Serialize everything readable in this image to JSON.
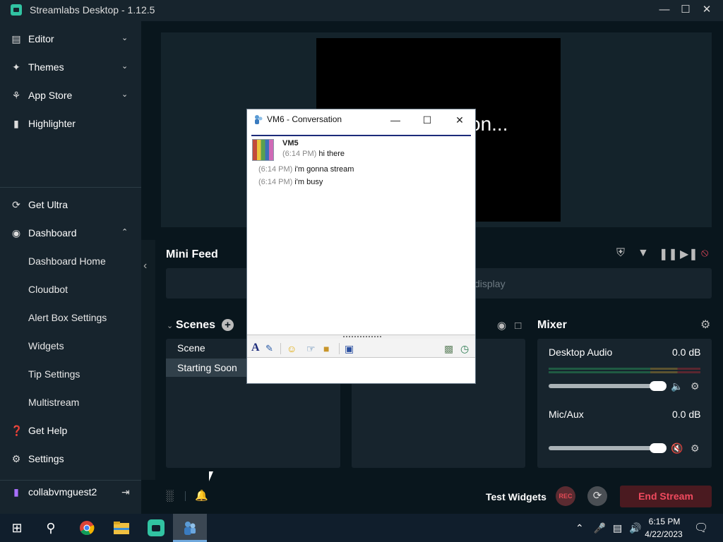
{
  "window": {
    "title": "Streamlabs Desktop - 1.12.5",
    "controls": [
      "minimize",
      "maximize",
      "close"
    ]
  },
  "sidebar": {
    "nav": [
      {
        "label": "Editor",
        "icon": "editor-icon",
        "chevron": "down"
      },
      {
        "label": "Themes",
        "icon": "themes-icon",
        "chevron": "down"
      },
      {
        "label": "App Store",
        "icon": "app-store-icon",
        "chevron": "down"
      },
      {
        "label": "Highlighter",
        "icon": "highlighter-icon"
      }
    ],
    "bottom": [
      {
        "label": "Get Ultra",
        "icon": "ultra-icon"
      },
      {
        "label": "Dashboard",
        "icon": "dashboard-icon",
        "chevron": "up"
      },
      {
        "label": "Dashboard Home"
      },
      {
        "label": "Cloudbot"
      },
      {
        "label": "Alert Box Settings"
      },
      {
        "label": "Widgets"
      },
      {
        "label": "Tip Settings"
      },
      {
        "label": "Multistream"
      },
      {
        "label": "Get Help",
        "icon": "help-icon"
      },
      {
        "label": "Settings",
        "icon": "gear-icon"
      }
    ],
    "user": {
      "name": "collabvmguest2",
      "icon": "twitch-icon"
    }
  },
  "preview": {
    "text": "on..."
  },
  "mini_feed": {
    "title": "Mini Feed",
    "message": "display",
    "controls": [
      "shield-icon",
      "filter-icon",
      "pause-icon",
      "skip-icon",
      "mute-alerts-icon"
    ]
  },
  "scenes": {
    "title": "Scenes",
    "items": [
      {
        "label": "Scene",
        "selected": false
      },
      {
        "label": "Starting Soon",
        "selected": true
      }
    ]
  },
  "mixer": {
    "title": "Mixer",
    "sources": [
      {
        "name": "Desktop Audio",
        "db": "0.0 dB",
        "level": 0.0
      },
      {
        "name": "Mic/Aux",
        "db": "0.0 dB",
        "level": 0.0
      }
    ]
  },
  "bottom_bar": {
    "test_widgets": "Test Widgets",
    "rec": "REC",
    "end_stream": "End Stream"
  },
  "conversation": {
    "title": "VM6 - Conversation",
    "sender": "VM5",
    "messages": [
      {
        "time": "(6:14 PM)",
        "text": "hi there"
      },
      {
        "time": "(6:14 PM)",
        "text": "i'm gonna stream"
      },
      {
        "time": "(6:14 PM)",
        "text": "i'm busy"
      }
    ],
    "input_value": ""
  },
  "taskbar": {
    "apps": [
      "windows-start-icon",
      "search-icon",
      "chrome-icon",
      "file-explorer-icon",
      "streamlabs-icon",
      "messenger-icon"
    ],
    "clock": {
      "time": "6:15 PM",
      "date": "4/22/2023"
    }
  },
  "colors": {
    "background": "#09161d",
    "panel": "#17242d",
    "accent": "#31c3a2",
    "end_stream": "#f04a5e"
  }
}
